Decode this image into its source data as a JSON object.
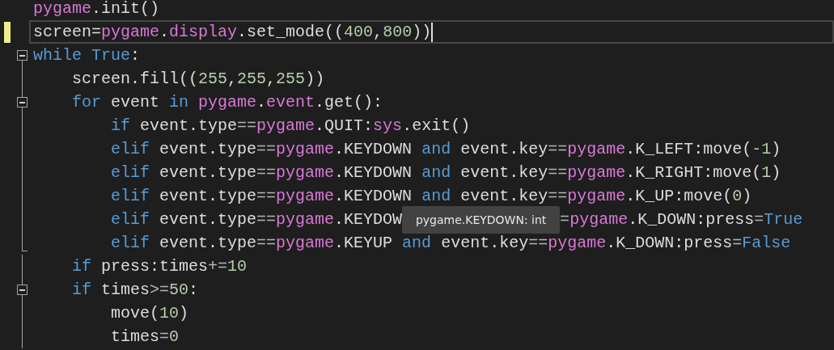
{
  "editor": {
    "lines": [
      {
        "kind": "none",
        "changed": false,
        "current": false,
        "tokens": [
          {
            "kind": "module",
            "text": "pygame"
          },
          {
            "kind": "plain",
            "text": ".init()"
          }
        ]
      },
      {
        "kind": "none",
        "changed": true,
        "current": true,
        "tokens": [
          {
            "kind": "plain",
            "text": "screen="
          },
          {
            "kind": "module",
            "text": "pygame"
          },
          {
            "kind": "plain",
            "text": "."
          },
          {
            "kind": "module",
            "text": "display"
          },
          {
            "kind": "plain",
            "text": ".set_mode(("
          },
          {
            "kind": "number",
            "text": "400"
          },
          {
            "kind": "plain",
            "text": ","
          },
          {
            "kind": "number",
            "text": "800"
          },
          {
            "kind": "plain",
            "text": "))"
          }
        ]
      },
      {
        "kind": "fold",
        "expanded": true,
        "changed": false,
        "current": false,
        "tokens": [
          {
            "kind": "keyword",
            "text": "while True"
          },
          {
            "kind": "plain",
            "text": ":"
          }
        ]
      },
      {
        "kind": "guide",
        "changed": false,
        "current": false,
        "tokens": [
          {
            "kind": "plain",
            "text": "    screen.fill(("
          },
          {
            "kind": "number",
            "text": "255"
          },
          {
            "kind": "plain",
            "text": ","
          },
          {
            "kind": "number",
            "text": "255"
          },
          {
            "kind": "plain",
            "text": ","
          },
          {
            "kind": "number",
            "text": "255"
          },
          {
            "kind": "plain",
            "text": "))"
          }
        ]
      },
      {
        "kind": "fold",
        "expanded": true,
        "changed": false,
        "current": false,
        "tokens": [
          {
            "kind": "keyword",
            "text": "    for"
          },
          {
            "kind": "plain",
            "text": " event "
          },
          {
            "kind": "keyword",
            "text": "in "
          },
          {
            "kind": "module",
            "text": "pygame"
          },
          {
            "kind": "plain",
            "text": "."
          },
          {
            "kind": "module",
            "text": "event"
          },
          {
            "kind": "plain",
            "text": ".get():"
          }
        ]
      },
      {
        "kind": "guide",
        "changed": false,
        "current": false,
        "tokens": [
          {
            "kind": "keyword",
            "text": "        if"
          },
          {
            "kind": "plain",
            "text": " event.type"
          },
          {
            "kind": "operator",
            "text": "=="
          },
          {
            "kind": "module",
            "text": "pygame"
          },
          {
            "kind": "plain",
            "text": ".QUIT:"
          },
          {
            "kind": "module",
            "text": "sys"
          },
          {
            "kind": "plain",
            "text": ".exit()"
          }
        ]
      },
      {
        "kind": "guide",
        "changed": false,
        "current": false,
        "tokens": [
          {
            "kind": "keyword",
            "text": "        elif"
          },
          {
            "kind": "plain",
            "text": " event.type"
          },
          {
            "kind": "operator",
            "text": "=="
          },
          {
            "kind": "module",
            "text": "pygame"
          },
          {
            "kind": "plain",
            "text": ".KEYDOWN "
          },
          {
            "kind": "keyword",
            "text": "and"
          },
          {
            "kind": "plain",
            "text": " event.key"
          },
          {
            "kind": "operator",
            "text": "=="
          },
          {
            "kind": "module",
            "text": "pygame"
          },
          {
            "kind": "plain",
            "text": ".K_LEFT:move("
          },
          {
            "kind": "number",
            "text": "-1"
          },
          {
            "kind": "plain",
            "text": ")"
          }
        ]
      },
      {
        "kind": "guide",
        "changed": false,
        "current": false,
        "tokens": [
          {
            "kind": "keyword",
            "text": "        elif"
          },
          {
            "kind": "plain",
            "text": " event.type"
          },
          {
            "kind": "operator",
            "text": "=="
          },
          {
            "kind": "module",
            "text": "pygame"
          },
          {
            "kind": "plain",
            "text": ".KEYDOWN "
          },
          {
            "kind": "keyword",
            "text": "and"
          },
          {
            "kind": "plain",
            "text": " event.key"
          },
          {
            "kind": "operator",
            "text": "=="
          },
          {
            "kind": "module",
            "text": "pygame"
          },
          {
            "kind": "plain",
            "text": ".K_RIGHT:move("
          },
          {
            "kind": "number",
            "text": "1"
          },
          {
            "kind": "plain",
            "text": ")"
          }
        ]
      },
      {
        "kind": "guide",
        "changed": false,
        "current": false,
        "tokens": [
          {
            "kind": "keyword",
            "text": "        elif"
          },
          {
            "kind": "plain",
            "text": " event.type"
          },
          {
            "kind": "operator",
            "text": "=="
          },
          {
            "kind": "module",
            "text": "pygame"
          },
          {
            "kind": "plain",
            "text": ".KEYDOWN "
          },
          {
            "kind": "keyword",
            "text": "and"
          },
          {
            "kind": "plain",
            "text": " event.key"
          },
          {
            "kind": "operator",
            "text": "=="
          },
          {
            "kind": "module",
            "text": "pygame"
          },
          {
            "kind": "plain",
            "text": ".K_UP:move("
          },
          {
            "kind": "number",
            "text": "0"
          },
          {
            "kind": "plain",
            "text": ")"
          }
        ]
      },
      {
        "kind": "guide",
        "changed": false,
        "current": false,
        "tokens": [
          {
            "kind": "keyword",
            "text": "        elif"
          },
          {
            "kind": "plain",
            "text": " event.type"
          },
          {
            "kind": "operator",
            "text": "=="
          },
          {
            "kind": "module",
            "text": "pygame"
          },
          {
            "kind": "plain",
            "text": ".KEYDOW"
          },
          {
            "kind": "tooltip",
            "text": "pygame.KEYDOWN: int"
          },
          {
            "kind": "operator",
            "text": "="
          },
          {
            "kind": "module",
            "text": "pygame"
          },
          {
            "kind": "plain",
            "text": ".K_DOWN:press"
          },
          {
            "kind": "operator",
            "text": "="
          },
          {
            "kind": "keyword",
            "text": "True"
          }
        ]
      },
      {
        "kind": "guide-end",
        "changed": false,
        "current": false,
        "tokens": [
          {
            "kind": "keyword",
            "text": "        elif"
          },
          {
            "kind": "plain",
            "text": " event.type"
          },
          {
            "kind": "operator",
            "text": "=="
          },
          {
            "kind": "module",
            "text": "pygame"
          },
          {
            "kind": "plain",
            "text": ".KEYUP "
          },
          {
            "kind": "keyword",
            "text": "and"
          },
          {
            "kind": "plain",
            "text": " event.key"
          },
          {
            "kind": "operator",
            "text": "=="
          },
          {
            "kind": "module",
            "text": "pygame"
          },
          {
            "kind": "plain",
            "text": ".K_DOWN:press"
          },
          {
            "kind": "operator",
            "text": "="
          },
          {
            "kind": "keyword",
            "text": "False"
          }
        ]
      },
      {
        "kind": "guide",
        "changed": false,
        "current": false,
        "tokens": [
          {
            "kind": "keyword",
            "text": "    if"
          },
          {
            "kind": "plain",
            "text": " press:times"
          },
          {
            "kind": "operator",
            "text": "+="
          },
          {
            "kind": "number",
            "text": "10"
          }
        ]
      },
      {
        "kind": "fold",
        "expanded": true,
        "changed": false,
        "current": false,
        "tokens": [
          {
            "kind": "keyword",
            "text": "    if"
          },
          {
            "kind": "plain",
            "text": " times"
          },
          {
            "kind": "operator",
            "text": ">="
          },
          {
            "kind": "number",
            "text": "50"
          },
          {
            "kind": "plain",
            "text": ":"
          }
        ]
      },
      {
        "kind": "guide",
        "changed": false,
        "current": false,
        "tokens": [
          {
            "kind": "plain",
            "text": "        move("
          },
          {
            "kind": "number",
            "text": "10"
          },
          {
            "kind": "plain",
            "text": ")"
          }
        ]
      },
      {
        "kind": "guide",
        "changed": false,
        "current": false,
        "tokens": [
          {
            "kind": "plain",
            "text": "        times"
          },
          {
            "kind": "operator",
            "text": "="
          },
          {
            "kind": "number",
            "text": "0"
          }
        ]
      }
    ]
  }
}
